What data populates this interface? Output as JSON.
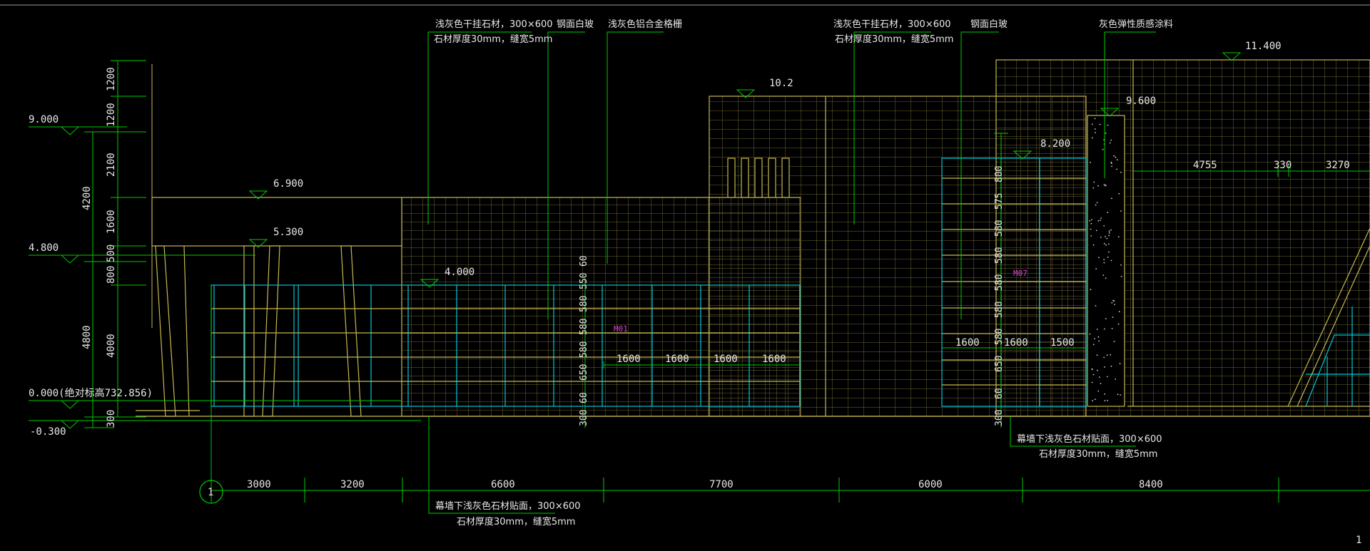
{
  "drawing": {
    "page_number_partial": "1",
    "colors": {
      "background": "#000000",
      "dimension": "#00cc00",
      "wall": "#c8b850",
      "glass": "#00c8d8",
      "text": "#e8e8e8",
      "tag": "#e040e0"
    }
  },
  "levels": {
    "left_900": "9.000",
    "left_480": "4.800",
    "left_000": "0.000(绝对标高732.856)",
    "left_m030": "-0.300",
    "l690": "6.900",
    "l530": "5.300",
    "l400": "4.000",
    "l102": "10.2",
    "l820": "8.200",
    "l960": "9.600",
    "l1140": "11.400"
  },
  "left_dims": {
    "outer": [
      "4200",
      "4800",
      "300"
    ],
    "inner": [
      "1200",
      "1200",
      "2100",
      "1600",
      "500",
      "800",
      "4000"
    ]
  },
  "bottom_dims": [
    "3000",
    "3200",
    "6600",
    "7700",
    "6000",
    "8400"
  ],
  "axis_label": "1",
  "window_dims_left": [
    "1600",
    "1600",
    "1600",
    "1600"
  ],
  "window_dims_right": [
    "1600",
    "1600",
    "1500"
  ],
  "right_top_dims": [
    "4755",
    "330",
    "3270"
  ],
  "vertical_dims_mid": [
    "300",
    "60",
    "650",
    "580",
    "580",
    "580",
    "550",
    "60"
  ],
  "vertical_dims_right": [
    "300",
    "60",
    "650",
    "580",
    "580",
    "580",
    "580",
    "580",
    "575",
    "800"
  ],
  "tags": {
    "m01": "M01",
    "m07": "M07"
  },
  "annotations": {
    "a1_line1": "浅灰色干挂石材，300×600",
    "a1_line2": "石材厚度30mm，缝宽5mm",
    "a2": "钢面白玻",
    "a3": "浅灰色铝合金格栅",
    "a4_line1": "浅灰色干挂石材，300×600",
    "a4_line2": "石材厚度30mm，缝宽5mm",
    "a5": "钢面白玻",
    "a6": "灰色弹性质感涂料",
    "b1_line1": "幕墙下浅灰色石材贴面，300×600",
    "b1_line2": "石材厚度30mm，缝宽5mm",
    "b2_line1": "幕墙下浅灰色石材贴面，300×600",
    "b2_line2": "石材厚度30mm，缝宽5mm"
  }
}
